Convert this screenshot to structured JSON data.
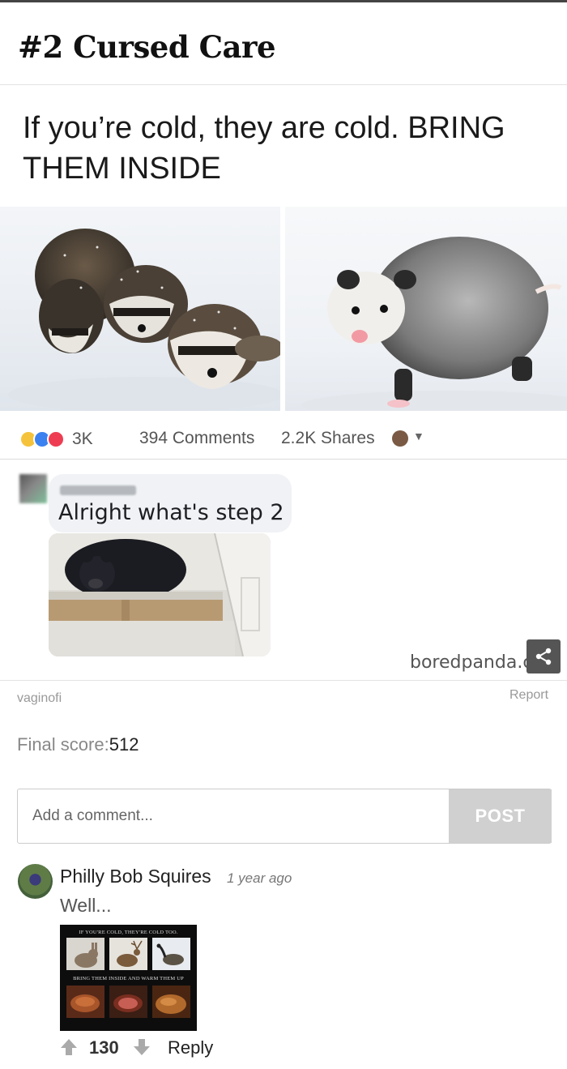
{
  "post": {
    "title": "#2 Cursed Care"
  },
  "meme": {
    "caption": "If you’re cold, they are cold. BRING THEM INSIDE",
    "facebook": {
      "reaction_count": "3K",
      "comments": "394 Comments",
      "shares": "2.2K Shares",
      "comment_text": "Alright what's step 2"
    },
    "watermark": "boredpanda.com"
  },
  "meta": {
    "author": "vaginofi",
    "report_label": "Report",
    "score_label": "Final score:",
    "score_value": "512"
  },
  "comment_form": {
    "placeholder": "Add a comment...",
    "post_label": "POST"
  },
  "comments": [
    {
      "author": "Philly Bob Squires",
      "time": "1 year ago",
      "text": "Well...",
      "image_caption_top": "IF YOU'RE COLD, THEY'RE COLD TOO.",
      "image_caption_bottom": "BRING THEM INSIDE AND WARM THEM UP",
      "votes": "130",
      "reply_label": "Reply"
    }
  ],
  "colors": {
    "post_button": "#d0d0d0",
    "muted_text": "#999999"
  }
}
